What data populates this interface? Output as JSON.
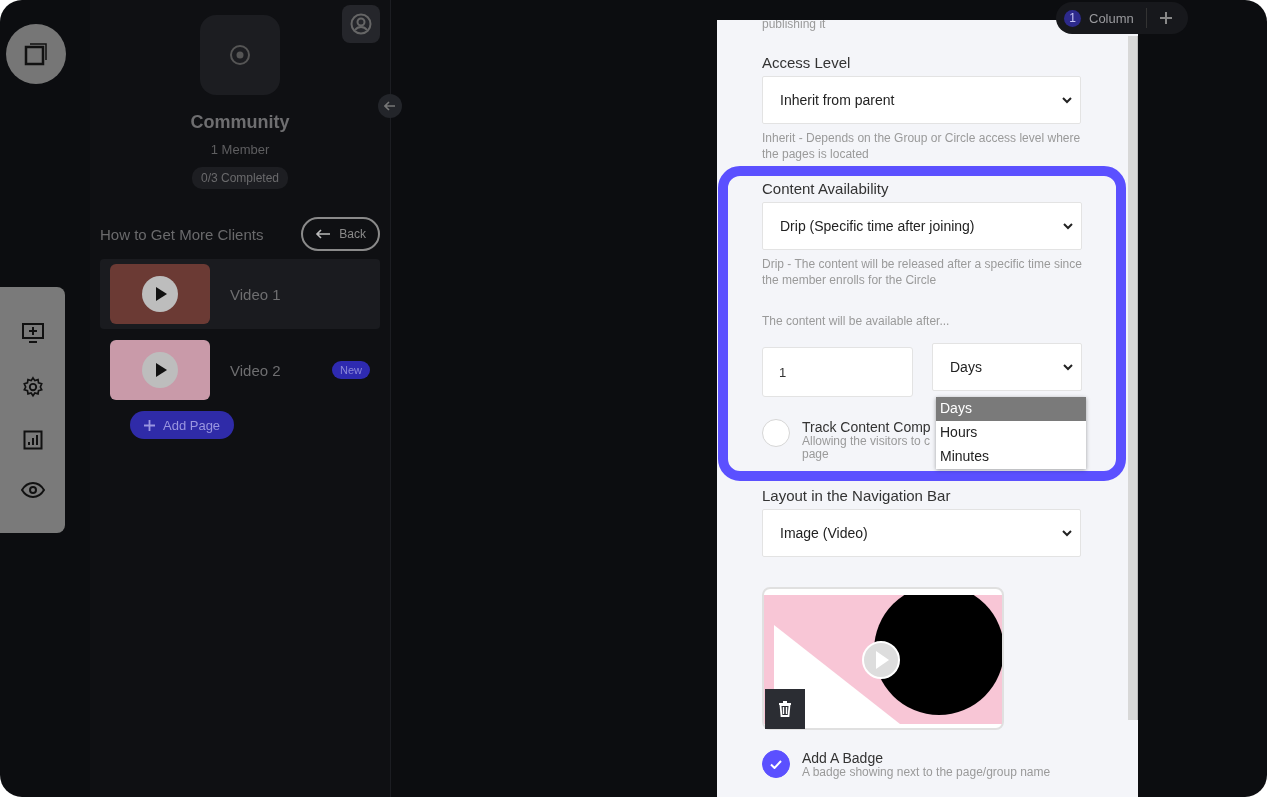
{
  "top_bar": {
    "column_count": "1",
    "column_label": "Column"
  },
  "sidebar": {
    "title": "Community",
    "members": "1 Member",
    "progress": "0/3 Completed",
    "section_title": "How to Get More Clients",
    "back_button": "Back",
    "pages": [
      {
        "title": "Video 1",
        "selected": true
      },
      {
        "title": "Video 2",
        "selected": false,
        "badge": "New"
      }
    ],
    "add_page": "Add Page"
  },
  "panel": {
    "top_note": "publishing it",
    "access_level": {
      "label": "Access Level",
      "value": "Inherit from parent",
      "hint": "Inherit - Depends on the Group or Circle access level where the pages is located"
    },
    "content_availability": {
      "label": "Content Availability",
      "value": "Drip (Specific time after joining)",
      "hint": "Drip - The content will be released after a specific time since the member enrolls for the Circle",
      "delay_label": "The content will be available after...",
      "delay_value": "1",
      "unit_value": "Days",
      "unit_options": [
        {
          "label": "Days",
          "selected": true
        },
        {
          "label": "Hours",
          "selected": false
        },
        {
          "label": "Minutes",
          "selected": false
        }
      ],
      "track": {
        "label": "Track Content Comp",
        "checked": false,
        "hint_lines": [
          "Allowing the visitors to c",
          "page"
        ]
      }
    },
    "layout": {
      "label": "Layout in the Navigation Bar",
      "value": "Image (Video)"
    },
    "badge": {
      "label": "Add A Badge",
      "checked": true,
      "hint": "A badge showing next to the page/group name"
    }
  }
}
